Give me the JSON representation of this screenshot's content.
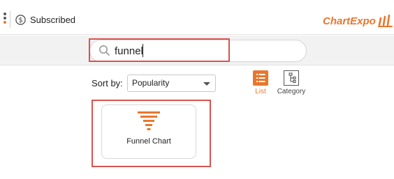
{
  "header": {
    "subscription_label": "Subscribed",
    "logo_text": "ChartExpo",
    "accent_color": "#e8772e"
  },
  "search": {
    "value": "funnel",
    "placeholder": ""
  },
  "sort": {
    "label": "Sort by:",
    "selected": "Popularity"
  },
  "view": {
    "list_label": "List",
    "category_label": "Category",
    "active": "List"
  },
  "results": [
    {
      "label": "Funnel Chart",
      "icon": "funnel-icon"
    }
  ],
  "highlight_color": "#d9534f"
}
